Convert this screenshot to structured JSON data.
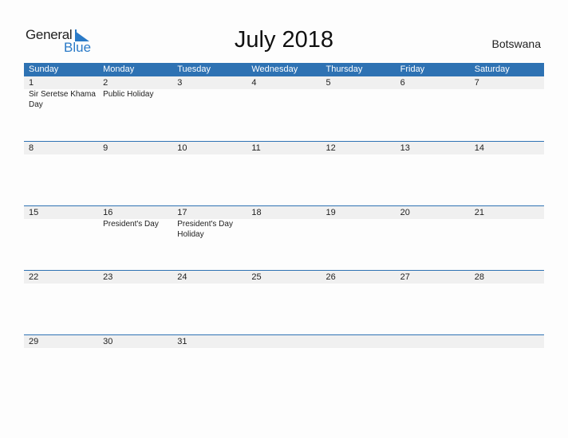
{
  "logo": {
    "word1": "General",
    "word2": "Blue"
  },
  "title": "July 2018",
  "country": "Botswana",
  "colors": {
    "accent": "#2e72b3",
    "logo_blue": "#2a7ac7",
    "date_band": "#f0f0f0"
  },
  "weekdays": [
    "Sunday",
    "Monday",
    "Tuesday",
    "Wednesday",
    "Thursday",
    "Friday",
    "Saturday"
  ],
  "weeks": [
    [
      {
        "day": "1",
        "event": "Sir Seretse Khama Day"
      },
      {
        "day": "2",
        "event": "Public Holiday"
      },
      {
        "day": "3",
        "event": ""
      },
      {
        "day": "4",
        "event": ""
      },
      {
        "day": "5",
        "event": ""
      },
      {
        "day": "6",
        "event": ""
      },
      {
        "day": "7",
        "event": ""
      }
    ],
    [
      {
        "day": "8",
        "event": ""
      },
      {
        "day": "9",
        "event": ""
      },
      {
        "day": "10",
        "event": ""
      },
      {
        "day": "11",
        "event": ""
      },
      {
        "day": "12",
        "event": ""
      },
      {
        "day": "13",
        "event": ""
      },
      {
        "day": "14",
        "event": ""
      }
    ],
    [
      {
        "day": "15",
        "event": ""
      },
      {
        "day": "16",
        "event": "President's Day"
      },
      {
        "day": "17",
        "event": "President's Day Holiday"
      },
      {
        "day": "18",
        "event": ""
      },
      {
        "day": "19",
        "event": ""
      },
      {
        "day": "20",
        "event": ""
      },
      {
        "day": "21",
        "event": ""
      }
    ],
    [
      {
        "day": "22",
        "event": ""
      },
      {
        "day": "23",
        "event": ""
      },
      {
        "day": "24",
        "event": ""
      },
      {
        "day": "25",
        "event": ""
      },
      {
        "day": "26",
        "event": ""
      },
      {
        "day": "27",
        "event": ""
      },
      {
        "day": "28",
        "event": ""
      }
    ],
    [
      {
        "day": "29",
        "event": ""
      },
      {
        "day": "30",
        "event": ""
      },
      {
        "day": "31",
        "event": ""
      },
      {
        "day": "",
        "event": ""
      },
      {
        "day": "",
        "event": ""
      },
      {
        "day": "",
        "event": ""
      },
      {
        "day": "",
        "event": ""
      }
    ]
  ]
}
